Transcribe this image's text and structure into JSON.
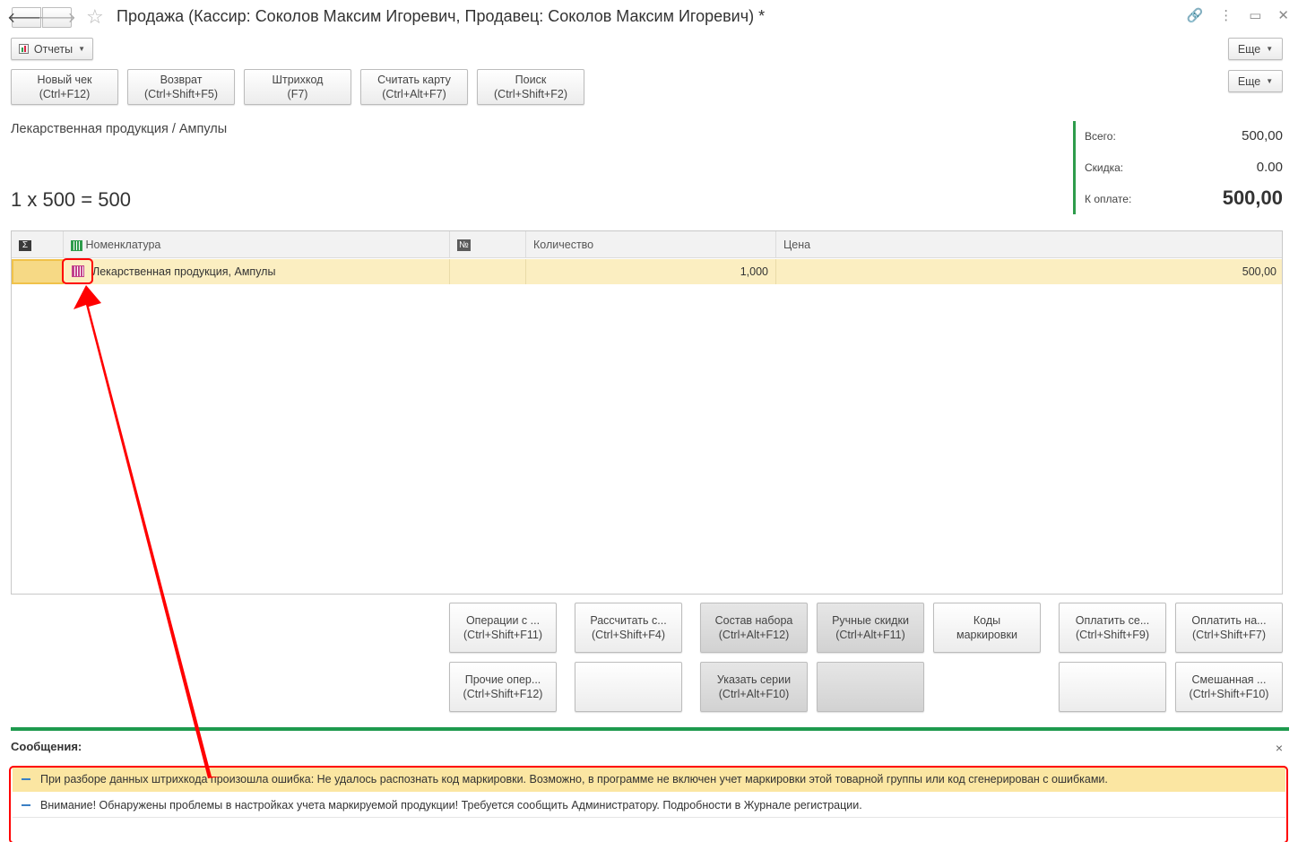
{
  "window": {
    "title": "Продажа (Кассир: Соколов Максим Игоревич, Продавец: Соколов Максим Игоревич) *"
  },
  "toolbar": {
    "reports_label": "Отчеты",
    "more_label_1": "Еще",
    "more_label_2": "Еще",
    "buttons": [
      {
        "line1": "Новый чек",
        "line2": "(Ctrl+F12)"
      },
      {
        "line1": "Возврат",
        "line2": "(Ctrl+Shift+F5)"
      },
      {
        "line1": "Штрихкод",
        "line2": "(F7)"
      },
      {
        "line1": "Считать карту",
        "line2": "(Ctrl+Alt+F7)"
      },
      {
        "line1": "Поиск",
        "line2": "(Ctrl+Shift+F2)"
      }
    ]
  },
  "current_item": {
    "path": "Лекарственная продукция / Ампулы",
    "formula": "1 x 500 = 500"
  },
  "totals": {
    "total_label": "Всего:",
    "total_value": "500,00",
    "discount_label": "Скидка:",
    "discount_value": "0.00",
    "to_pay_label": "К оплате:",
    "to_pay_value": "500,00"
  },
  "table": {
    "columns": {
      "nomenclature": "Номенклатура",
      "number": "№",
      "quantity": "Количество",
      "price": "Цена"
    },
    "rows": [
      {
        "name": "Лекарственная продукция, Ампулы",
        "number": "",
        "quantity": "1,000",
        "price": "500,00"
      }
    ]
  },
  "actions": {
    "operations": {
      "line1": "Операции с ...",
      "line2": "(Ctrl+Shift+F11)"
    },
    "calculate": {
      "line1": "Рассчитать с...",
      "line2": "(Ctrl+Shift+F4)"
    },
    "set_content": {
      "line1": "Состав набора",
      "line2": "(Ctrl+Alt+F12)"
    },
    "manual_discounts": {
      "line1": "Ручные скидки",
      "line2": "(Ctrl+Alt+F11)"
    },
    "marking_codes": {
      "line1": "Коды",
      "line2": "маркировки"
    },
    "pay_cert": {
      "line1": "Оплатить се...",
      "line2": "(Ctrl+Shift+F9)"
    },
    "pay_cash": {
      "line1": "Оплатить на...",
      "line2": "(Ctrl+Shift+F7)"
    },
    "other_ops": {
      "line1": "Прочие опер...",
      "line2": "(Ctrl+Shift+F12)"
    },
    "series": {
      "line1": "Указать серии",
      "line2": "(Ctrl+Alt+F10)"
    },
    "mixed": {
      "line1": "Смешанная ...",
      "line2": "(Ctrl+Shift+F10)"
    }
  },
  "messages": {
    "title": "Сообщения:",
    "close": "×",
    "items": [
      "При разборе данных штрихкода произошла ошибка: Не удалось распознать код маркировки. Возможно, в программе не включен учет маркировки этой товарной группы или код сгенерирован с ошибками.",
      "Внимание! Обнаружены проблемы в настройках учета маркируемой продукции! Требуется сообщить Администратору. Подробности в Журнале регистрации."
    ]
  },
  "colors": {
    "accent_green": "#1e9a4e",
    "row_highlight": "#fbeec1",
    "annotation_red": "#ff0000"
  }
}
